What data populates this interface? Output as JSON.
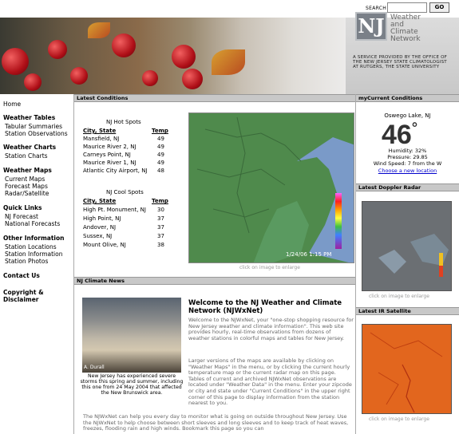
{
  "search": {
    "label": "SEARCH",
    "go": "GO"
  },
  "banner": {
    "logo": "NJ",
    "logo_lines": [
      "Weather",
      "and",
      "Climate",
      "Network"
    ],
    "provided": [
      "A SERVICE PROVIDED BY THE OFFICE OF",
      "THE NEW JERSEY STATE CLIMATOLOGIST",
      "AT RUTGERS, THE STATE UNIVERSITY"
    ]
  },
  "nav": {
    "home": "Home",
    "weather_tables": {
      "head": "Weather Tables",
      "items": [
        "Tabular Summaries",
        "Station Observations"
      ]
    },
    "weather_charts": {
      "head": "Weather Charts",
      "items": [
        "Station Charts"
      ]
    },
    "weather_maps": {
      "head": "Weather Maps",
      "items": [
        "Current Maps",
        "Forecast Maps",
        "Radar/Satellite"
      ]
    },
    "quick_links": {
      "head": "Quick Links",
      "items": [
        "NJ Forecast",
        "National Forecasts"
      ]
    },
    "other_info": {
      "head": "Other Information",
      "items": [
        "Station Locations",
        "Station Information",
        "Station Photos"
      ]
    },
    "contact": "Contact Us",
    "copyright": [
      "Copyright &",
      "Disclaimer"
    ]
  },
  "latest": {
    "head": "Latest Conditions",
    "hot_title": "NJ Hot Spots",
    "cool_title": "NJ Cool Spots",
    "col_city": "City, State",
    "col_temp": "Temp",
    "hot": [
      [
        "Mansfield, NJ",
        "49"
      ],
      [
        "Maurice River 2, NJ",
        "49"
      ],
      [
        "Carneys Point, NJ",
        "49"
      ],
      [
        "Maurice River 1, NJ",
        "49"
      ],
      [
        "Atlantic City Airport, NJ",
        "48"
      ]
    ],
    "cool": [
      [
        "High Pt. Monument, NJ",
        "30"
      ],
      [
        "High Point, NJ",
        "37"
      ],
      [
        "Andover, NJ",
        "37"
      ],
      [
        "Sussex, NJ",
        "37"
      ],
      [
        "Mount Olive, NJ",
        "38"
      ]
    ],
    "map_stamp": "1/24/06  1:15 PM",
    "map_caption": "click on image to enlarge",
    "scale": [
      "120",
      "100",
      "80",
      "60",
      "40",
      "20",
      "0",
      "-20"
    ]
  },
  "news": {
    "head": "NJ Climate News",
    "photo_credit": "A. Durall",
    "story": "New Jersey has experienced severe storms this spring and summer, including this one from 24 May 2004 that affected the New Brunswick area.",
    "welcome": "Welcome to the NJ Weather and Climate Network (NJWxNet)",
    "p1": "Welcome to the NJWxNet, your \"one-stop shopping resource for New Jersey weather and climate information\". This web site provides hourly, real-time observations from dozens of weather stations in colorful maps and tables for New Jersey.",
    "p2": "Larger versions of the maps are available by clicking on \"Weather Maps\" in the menu, or by clicking the current hourly temperature map or the current radar map on this page. Tables of current and archived NJWxNet observations are located under \"Weather Data\" in the menu. Enter your zipcode or city and state under \"Current Conditions\" in the upper right corner of this page to display information from the station nearest to you.",
    "p3": "The NJWxNet can help you every day to monitor what is going on outside throughout New Jersey. Use the NJWxNet to help choose between short sleeves and long sleeves and to keep track of heat waves, freezes, flooding rain and high winds. Bookmark this page so you can"
  },
  "current": {
    "head": "myCurrent Conditions",
    "location": "Oswego Lake, NJ",
    "temp": "46",
    "deg": "°",
    "humidity": "Humidity: 32%",
    "pressure": "Pressure: 29.85",
    "wind": "Wind Speed: 7 from the W",
    "link": "Choose a new location"
  },
  "radar": {
    "head": "Latest Doppler Radar",
    "caption": "click on image to enlarge"
  },
  "ir": {
    "head": "Latest IR Satellite",
    "caption": "click on image to enlarge"
  }
}
